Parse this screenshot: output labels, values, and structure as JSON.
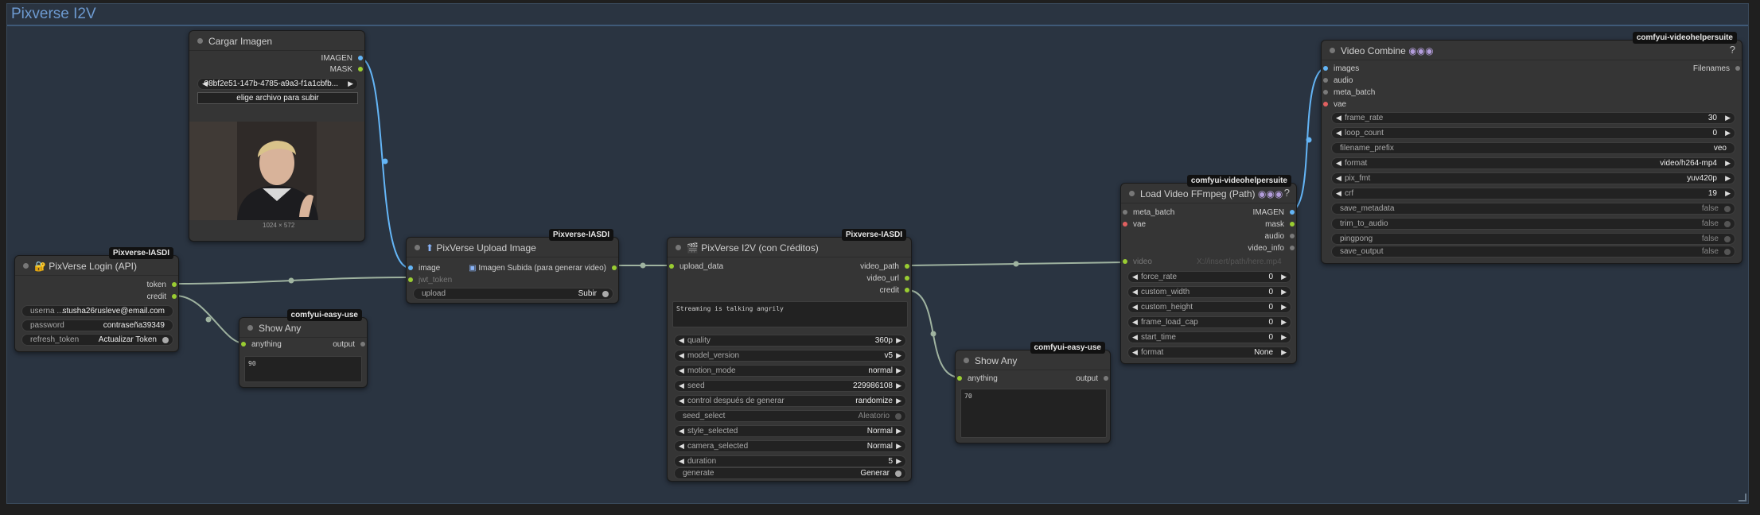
{
  "group": {
    "title": "Pixverse I2V"
  },
  "nodes": {
    "load_image": {
      "title": "Cargar Imagen",
      "outputs": [
        "IMAGEN",
        "MASK"
      ],
      "file": "08bf2e51-147b-4785-a9a3-f1a1cbfb...",
      "upload_button": "elige archivo para subir",
      "size": "1024 × 572"
    },
    "login": {
      "title": "PixVerse Login (API)",
      "badge": "Pixverse-IASDI",
      "outputs": [
        "token",
        "credit"
      ],
      "widgets": [
        {
          "label": "userna ...",
          "value": "stusha26rusleve@email.com"
        },
        {
          "label": "password",
          "value": "contraseña39349"
        },
        {
          "label": "refresh_token",
          "value": "Actualizar Token"
        }
      ]
    },
    "show_any_1": {
      "title": "Show Any",
      "badge": "comfyui-easy-use",
      "input": "anything",
      "output": "output",
      "text": "90"
    },
    "upload": {
      "title": "PixVerse Upload Image",
      "badge": "Pixverse-IASDI",
      "inputs": [
        "image",
        "jwt_token"
      ],
      "output": "Imagen Subida (para generar video)",
      "widget": {
        "label": "upload",
        "value": "Subir"
      }
    },
    "i2v": {
      "title": "PixVerse I2V (con Créditos)",
      "badge": "Pixverse-IASDI",
      "input": "upload_data",
      "outputs": [
        "video_path",
        "video_url",
        "credit"
      ],
      "prompt": "Streaming is talking angrily",
      "widgets": [
        {
          "label": "quality",
          "value": "360p"
        },
        {
          "label": "model_version",
          "value": "v5"
        },
        {
          "label": "motion_mode",
          "value": "normal"
        },
        {
          "label": "seed",
          "value": "229986108"
        },
        {
          "label": "control después de generar",
          "value": "randomize"
        },
        {
          "label": "seed_select",
          "value": "Aleatorio"
        },
        {
          "label": "style_selected",
          "value": "Normal"
        },
        {
          "label": "camera_selected",
          "value": "Normal"
        },
        {
          "label": "duration",
          "value": "5"
        },
        {
          "label": "generate",
          "value": "Generar"
        }
      ]
    },
    "show_any_2": {
      "title": "Show Any",
      "badge": "comfyui-easy-use",
      "input": "anything",
      "output": "output",
      "text": "70"
    },
    "load_video": {
      "title": "Load Video FFmpeg (Path)",
      "badge": "comfyui-videohelpersuite",
      "inputs": [
        "meta_batch",
        "vae"
      ],
      "outputs": [
        "IMAGEN",
        "mask",
        "audio",
        "video_info"
      ],
      "video": {
        "label": "video",
        "value": "X://insert/path/here.mp4"
      },
      "widgets": [
        {
          "label": "force_rate",
          "value": "0"
        },
        {
          "label": "custom_width",
          "value": "0"
        },
        {
          "label": "custom_height",
          "value": "0"
        },
        {
          "label": "frame_load_cap",
          "value": "0"
        },
        {
          "label": "start_time",
          "value": "0"
        },
        {
          "label": "format",
          "value": "None"
        }
      ]
    },
    "video_combine": {
      "title": "Video Combine",
      "badge": "comfyui-videohelpersuite",
      "inputs": [
        "images",
        "audio",
        "meta_batch",
        "vae"
      ],
      "output": "Filenames",
      "widgets": [
        {
          "label": "frame_rate",
          "value": "30"
        },
        {
          "label": "loop_count",
          "value": "0"
        },
        {
          "label": "filename_prefix",
          "value": "veo"
        },
        {
          "label": "format",
          "value": "video/h264-mp4"
        },
        {
          "label": "pix_fmt",
          "value": "yuv420p"
        },
        {
          "label": "crf",
          "value": "19"
        },
        {
          "label": "save_metadata",
          "value": "false"
        },
        {
          "label": "trim_to_audio",
          "value": "false"
        },
        {
          "label": "pingpong",
          "value": "false"
        },
        {
          "label": "save_output",
          "value": "false"
        }
      ]
    }
  },
  "icons": {
    "title_dot": "circle",
    "help": "?",
    "arrow_left": "◀",
    "arrow_right": "▶"
  },
  "colors": {
    "canvas": "#2a3441",
    "link_image": "#64b5f6",
    "link_generic": "#9fb3a0",
    "group_title": "#6d9ad0"
  }
}
